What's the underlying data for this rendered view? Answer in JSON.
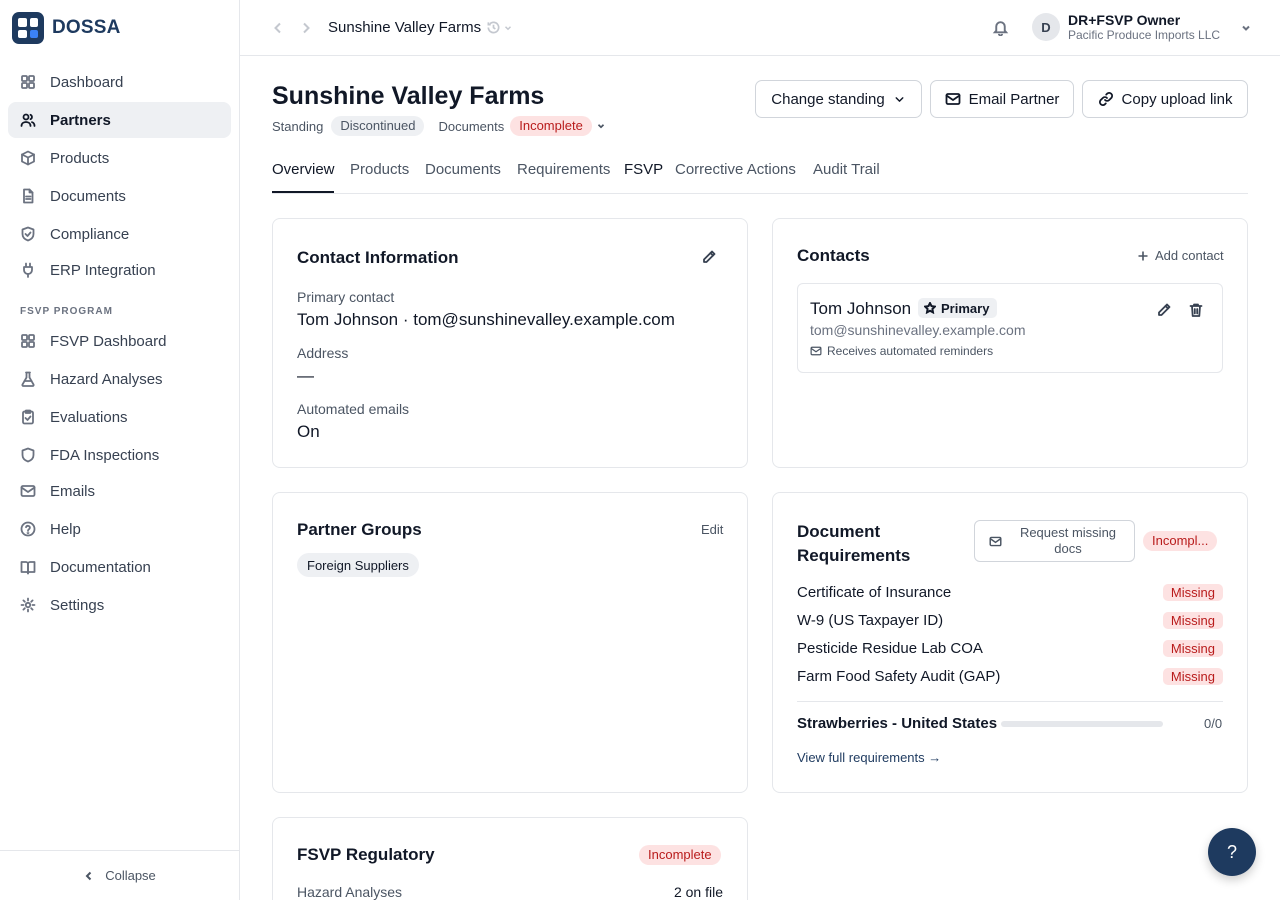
{
  "app": {
    "logo_text": "DOSSA"
  },
  "sidebar": {
    "items": [
      {
        "label": "Dashboard",
        "icon": "dashboard-icon"
      },
      {
        "label": "Partners",
        "icon": "users-icon",
        "active": true
      },
      {
        "label": "Products",
        "icon": "package-icon"
      },
      {
        "label": "Documents",
        "icon": "file-icon"
      },
      {
        "label": "Compliance",
        "icon": "shield-check-icon"
      },
      {
        "label": "ERP Integration",
        "icon": "plug-icon"
      }
    ],
    "section_label": "FSVP PROGRAM",
    "fsvp_items": [
      {
        "label": "FSVP Dashboard",
        "icon": "dashboard-icon"
      },
      {
        "label": "Hazard Analyses",
        "icon": "flask-icon"
      },
      {
        "label": "Evaluations",
        "icon": "clipboard-icon"
      },
      {
        "label": "FDA Inspections",
        "icon": "shield-icon"
      },
      {
        "label": "Emails",
        "icon": "mail-icon"
      },
      {
        "label": "Help",
        "icon": "help-circle-icon"
      },
      {
        "label": "Documentation",
        "icon": "book-icon"
      },
      {
        "label": "Settings",
        "icon": "gear-icon"
      }
    ],
    "collapse_label": "Collapse"
  },
  "topbar": {
    "breadcrumb": "Sunshine Valley Farms",
    "user_initial": "D",
    "user_name": "DR+FSVP Owner",
    "user_org": "Pacific Produce Imports LLC"
  },
  "header": {
    "title": "Sunshine Valley Farms",
    "standing_label": "Standing",
    "standing_value": "Discontinued",
    "documents_label": "Documents",
    "documents_status": "Incomplete",
    "change_standing_label": "Change standing",
    "email_partner_label": "Email Partner",
    "copy_upload_label": "Copy upload link"
  },
  "tabs": [
    "Overview",
    "Products",
    "Documents",
    "Requirements",
    "FSVP",
    "Corrective Actions",
    "Audit Trail"
  ],
  "contact_info": {
    "title": "Contact Information",
    "primary_label": "Primary contact",
    "primary_value": "Tom Johnson · tom@sunshinevalley.example.com",
    "address_label": "Address",
    "address_value": "—",
    "emails_label": "Automated emails",
    "emails_value": "On"
  },
  "contacts": {
    "title": "Contacts",
    "add_label": "Add contact",
    "name": "Tom Johnson",
    "badge": "Primary",
    "email": "tom@sunshinevalley.example.com",
    "note": "Receives automated reminders"
  },
  "partner_groups": {
    "title": "Partner Groups",
    "edit_label": "Edit",
    "chip": "Foreign Suppliers"
  },
  "doc_requirements": {
    "title_line1": "Document",
    "title_line2": "Requirements",
    "request_line1": "Request missing",
    "request_line2": "docs",
    "status": "Incompl...",
    "items": [
      {
        "name": "Certificate of Insurance",
        "status": "Missing"
      },
      {
        "name": "W-9 (US Taxpayer ID)",
        "status": "Missing"
      },
      {
        "name": "Pesticide Residue Lab COA",
        "status": "Missing"
      },
      {
        "name": "Farm Food Safety Audit (GAP)",
        "status": "Missing"
      }
    ],
    "product_label": "Strawberries - United States",
    "product_count": "0/0",
    "progress_fraction": 0,
    "view_link": "View full requirements →"
  },
  "fsvp_regulatory": {
    "title": "FSVP Regulatory",
    "status": "Incomplete",
    "row_label": "Hazard Analyses",
    "row_value": "2 on file"
  },
  "help_fab": "?"
}
